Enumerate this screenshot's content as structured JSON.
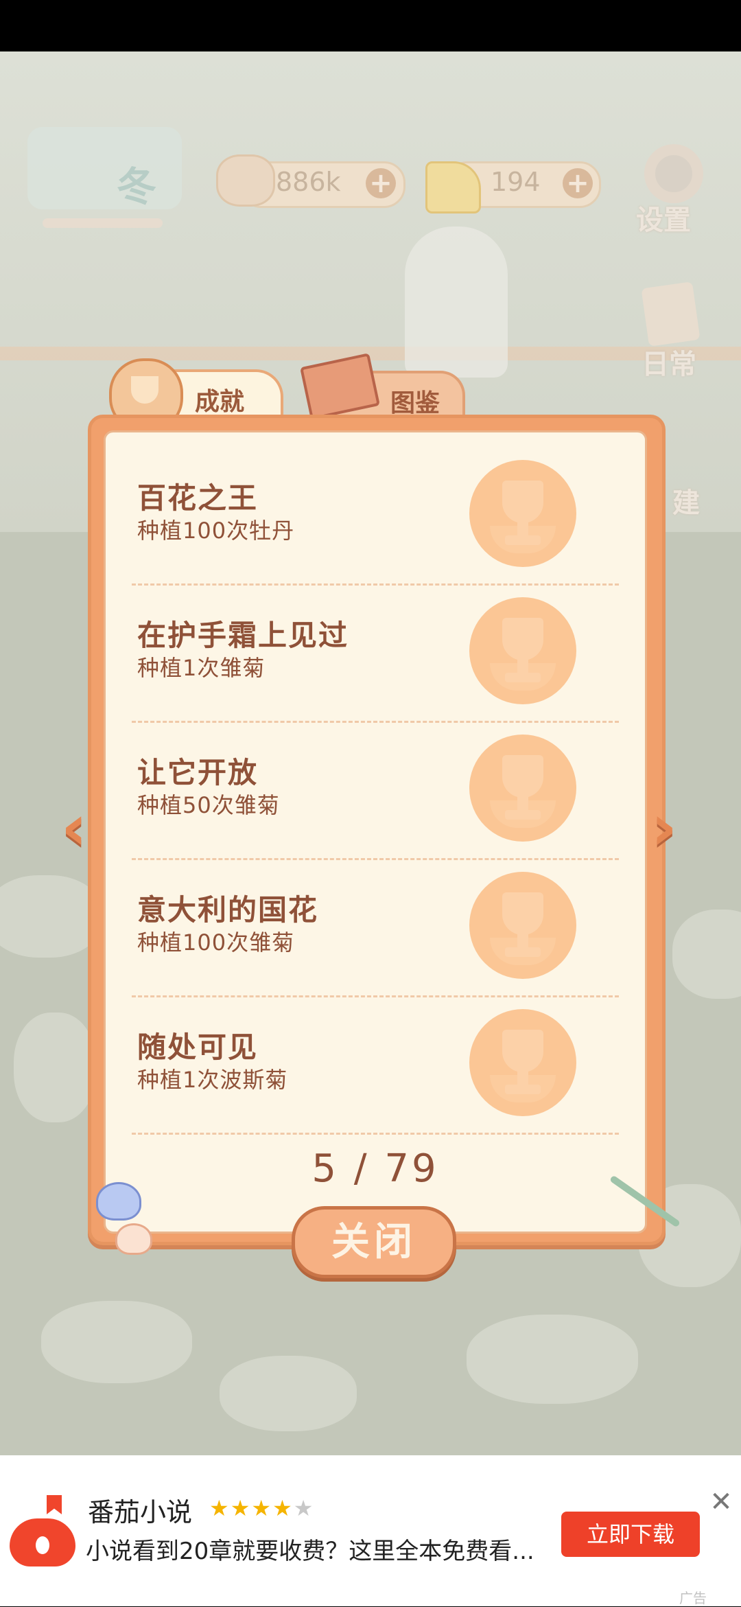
{
  "hud": {
    "season_label": "冬",
    "fish_value": "886k",
    "cheese_value": "194",
    "plus": "+",
    "settings_label": "设置",
    "daily_label": "日常",
    "build_label": "建"
  },
  "tabs": {
    "achievements": "成就",
    "collection": "图鉴"
  },
  "achievements": [
    {
      "title": "百花之王",
      "desc": "种植100次牡丹"
    },
    {
      "title": "在护手霜上见过",
      "desc": "种植1次雏菊"
    },
    {
      "title": "让它开放",
      "desc": "种植50次雏菊"
    },
    {
      "title": "意大利的国花",
      "desc": "种植100次雏菊"
    },
    {
      "title": "随处可见",
      "desc": "种植1次波斯菊"
    }
  ],
  "page_counter": "5 / 79",
  "nav": {
    "prev": "‹",
    "next": "›"
  },
  "close_label": "关闭",
  "ad": {
    "title": "番茄小说",
    "rating": 4,
    "rating_max": 5,
    "stars": {
      "s1": "★",
      "s2": "★",
      "s3": "★",
      "s4": "★",
      "s5": "★"
    },
    "description": "小说看到20章就要收费？这里全本免费看...",
    "cta": "立即下载",
    "close": "✕",
    "tag": "广告"
  }
}
